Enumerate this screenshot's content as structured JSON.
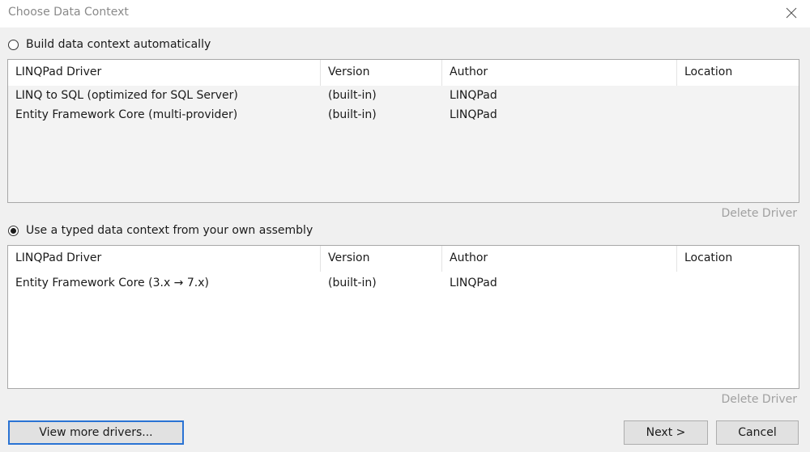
{
  "window": {
    "title": "Choose Data Context",
    "close_icon": "close-icon"
  },
  "option_auto": {
    "label": "Build data context automatically",
    "selected": false
  },
  "list_auto": {
    "columns": [
      "LINQPad Driver",
      "Version",
      "Author",
      "Location"
    ],
    "rows": [
      {
        "driver": "LINQ to SQL (optimized for SQL Server)",
        "version": "(built-in)",
        "author": "LINQPad",
        "location": ""
      },
      {
        "driver": "Entity Framework Core (multi-provider)",
        "version": "(built-in)",
        "author": "LINQPad",
        "location": ""
      }
    ],
    "delete_label": "Delete Driver"
  },
  "option_typed": {
    "label": "Use a typed data context from your own assembly",
    "selected": true
  },
  "list_typed": {
    "columns": [
      "LINQPad Driver",
      "Version",
      "Author",
      "Location"
    ],
    "rows": [
      {
        "driver": "Entity Framework Core (3.x → 7.x)",
        "version": "(built-in)",
        "author": "LINQPad",
        "location": ""
      }
    ],
    "delete_label": "Delete Driver"
  },
  "buttons": {
    "more_drivers": "View more drivers...",
    "next": "Next >",
    "cancel": "Cancel"
  }
}
